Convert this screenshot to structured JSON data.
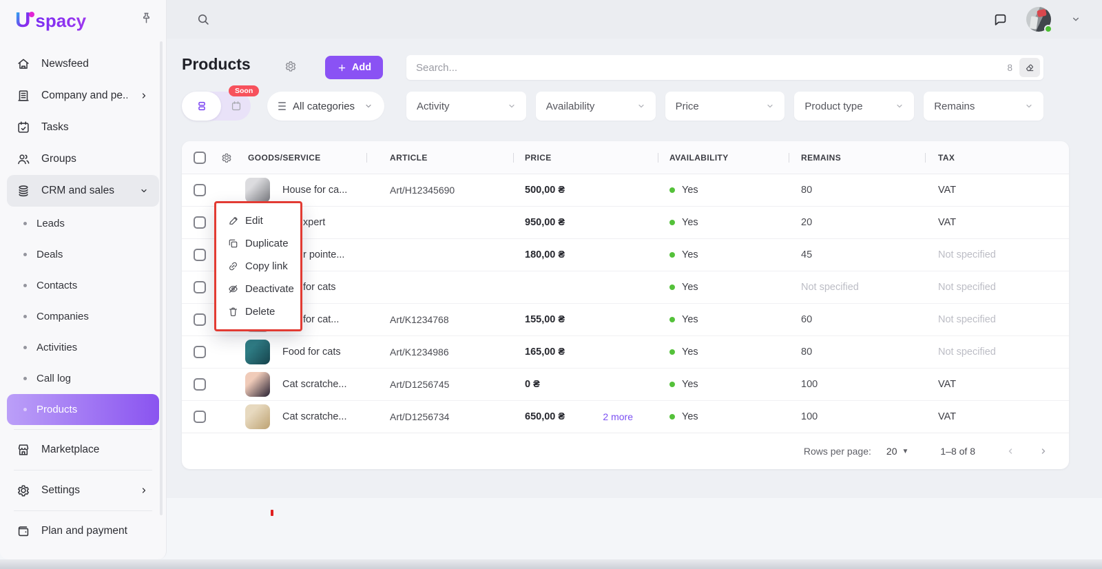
{
  "brand": {
    "initial": "U",
    "name": "spacy"
  },
  "sidebar": {
    "items": [
      {
        "id": "newsfeed",
        "label": "Newsfeed",
        "icon": "home"
      },
      {
        "id": "company",
        "label": "Company and pe...",
        "icon": "building",
        "chevron": "right"
      },
      {
        "id": "tasks",
        "label": "Tasks",
        "icon": "calendar"
      },
      {
        "id": "groups",
        "label": "Groups",
        "icon": "people"
      },
      {
        "id": "crm",
        "label": "CRM and sales",
        "icon": "layers",
        "chevron": "down",
        "expanded": true
      }
    ],
    "crm_children": [
      {
        "label": "Leads"
      },
      {
        "label": "Deals"
      },
      {
        "label": "Contacts"
      },
      {
        "label": "Companies"
      },
      {
        "label": "Activities"
      },
      {
        "label": "Call log"
      },
      {
        "label": "Products",
        "active": true
      }
    ],
    "bottom_items": [
      {
        "id": "marketplace",
        "label": "Marketplace",
        "icon": "store"
      },
      {
        "id": "settings",
        "label": "Settings",
        "icon": "gear",
        "chevron": "right"
      },
      {
        "id": "plan",
        "label": "Plan and payment",
        "icon": "wallet"
      }
    ]
  },
  "header": {
    "title": "Products",
    "add_label": "Add",
    "search_placeholder": "Search...",
    "search_count": "8",
    "soon_badge": "Soon",
    "categories_label": "All categories"
  },
  "filters": [
    "Activity",
    "Availability",
    "Price",
    "Product type",
    "Remains"
  ],
  "table": {
    "columns": [
      "GOODS/SERVICE",
      "ARTICLE",
      "PRICE",
      "AVAILABILITY",
      "REMAINS",
      "TAX"
    ],
    "rows": [
      {
        "name": "House for ca...",
        "article": "Art/H12345690",
        "price": "500,00 ₴",
        "more": "",
        "availability": "Yes",
        "remains": "80",
        "tax": "VAT",
        "thumb": [
          "#dcdcdf",
          "#77787d"
        ]
      },
      {
        "name": "xpert",
        "article": "",
        "price": "950,00 ₴",
        "more": "",
        "availability": "Yes",
        "remains": "20",
        "tax": "VAT",
        "occluded": "full"
      },
      {
        "name": "r pointe...",
        "article": "",
        "price": "180,00 ₴",
        "more": "",
        "availability": "Yes",
        "remains": "45",
        "tax": "Not specified",
        "occluded": "full"
      },
      {
        "name": "for cats",
        "article": "",
        "price": "",
        "more": "",
        "availability": "Yes",
        "remains": "Not specified",
        "tax": "Not specified",
        "occluded": "full"
      },
      {
        "name": "for cat...",
        "article": "Art/K1234768",
        "price": "155,00 ₴",
        "more": "",
        "availability": "Yes",
        "remains": "60",
        "tax": "Not specified",
        "occluded": "partial",
        "thumb": [
          "#cfcfd3",
          "#9b9ca1"
        ]
      },
      {
        "name": "Food for cats",
        "article": "Art/K1234986",
        "price": "165,00 ₴",
        "more": "",
        "availability": "Yes",
        "remains": "80",
        "tax": "Not specified",
        "thumb": [
          "#2f7d85",
          "#16424b"
        ]
      },
      {
        "name": "Cat scratche...",
        "article": "Art/D1256745",
        "price": "0 ₴",
        "more": "",
        "availability": "Yes",
        "remains": "100",
        "tax": "VAT",
        "thumb": [
          "#f0cbb9",
          "#282132"
        ]
      },
      {
        "name": "Cat scratche...",
        "article": "Art/D1256734",
        "price": "650,00 ₴",
        "more": "2 more",
        "availability": "Yes",
        "remains": "100",
        "tax": "VAT",
        "thumb": [
          "#e7d9bf",
          "#bda272"
        ]
      }
    ],
    "not_specified_text": "Not specified"
  },
  "context_menu": {
    "items": [
      {
        "icon": "pencil",
        "label": "Edit"
      },
      {
        "icon": "duplicate",
        "label": "Duplicate"
      },
      {
        "icon": "link",
        "label": "Copy link"
      },
      {
        "icon": "eye-off",
        "label": "Deactivate"
      },
      {
        "icon": "trash",
        "label": "Delete"
      }
    ]
  },
  "pagination": {
    "label": "Rows per page:",
    "value": "20",
    "range": "1–8 of 8"
  },
  "colors": {
    "accent": "#8a52f4",
    "soon_red": "#f7515c",
    "green": "#54c13a",
    "menu_border_red": "#e23b33"
  }
}
